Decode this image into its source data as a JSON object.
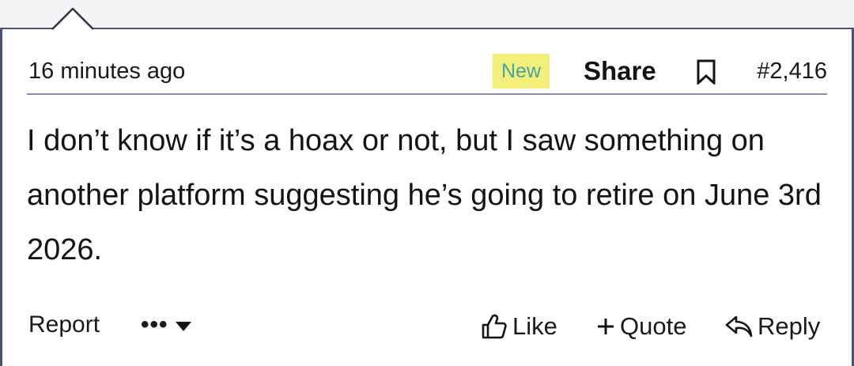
{
  "post": {
    "timestamp": "16 minutes ago",
    "badge": "New",
    "share_label": "Share",
    "post_number": "#2,416",
    "body": "I don’t know if it’s a hoax or not, but I saw something on another platform suggesting he’s going to retire on June 3rd 2026."
  },
  "footer": {
    "report_label": "Report",
    "more_label": "•••",
    "like_label": "Like",
    "quote_label": "Quote",
    "reply_label": "Reply"
  },
  "icons": {
    "bookmark": "bookmark-icon",
    "caret": "caret-down-icon",
    "like": "thumbs-up-icon",
    "quote": "plus-icon",
    "reply": "reply-arrow-icon",
    "pointer": "speech-pointer"
  },
  "colors": {
    "border": "#4a4f86",
    "divider": "#8a8da8",
    "badge_bg": "#f2f07a",
    "badge_text": "#47a3a6",
    "text": "#141414"
  }
}
